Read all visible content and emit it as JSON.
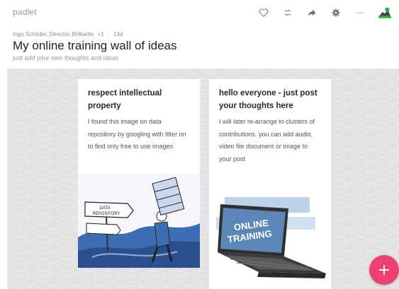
{
  "app": {
    "brand": "padlet"
  },
  "toolbar": {
    "icons": [
      "heart-icon",
      "remake-icon",
      "share-icon",
      "gear-icon",
      "more-icon",
      "avatar-icon"
    ]
  },
  "header": {
    "author": "Ingo Schöder, Director, Brillianto",
    "contributors": "+1",
    "separator": "·",
    "age": "13d",
    "title": "My online training wall of ideas",
    "subtitle": "just add your own thoughts and ideas"
  },
  "posts": [
    {
      "title": "respect intellectual property",
      "body": "I found this image on data repository by googling with filter on to find only free to use images",
      "image_sign": [
        "DATA",
        "REPOSITORY"
      ]
    },
    {
      "title": "hello everyone - just post your thoughts here",
      "body": "I will later re-arrange in clusters of contributions. you can add audio, video file document or image to your post",
      "image_screen": [
        "ONLINE",
        "TRAINING"
      ]
    }
  ],
  "fab": {
    "label": "+"
  },
  "colors": {
    "fab": "#ef3f73",
    "wall": "#e6e6e6",
    "illustration_blue": "#2f5fa8",
    "avatar_green": "#2db34a"
  }
}
